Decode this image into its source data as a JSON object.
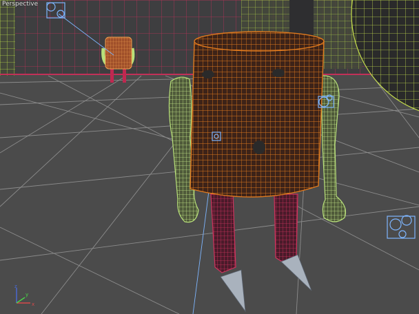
{
  "viewport": {
    "label": "Perspective",
    "active": true,
    "background": "#4b4b4b"
  },
  "colors": {
    "grid": "#8c8c8c",
    "character_body_wire": "#e07a1e",
    "character_body_fill": "#4a2a1c",
    "character_arm_wire": "#b8e07a",
    "character_leg_wire": "#d1335e",
    "foot_fill": "#a9b2bd",
    "light_helper": "#7eb6ff",
    "room_wall_wire": "#d1335e",
    "room_green_wire": "#b7d84a",
    "sphere_wire": "#c6de4c",
    "axis_x": "#d84a4a",
    "axis_y": "#4ad84a",
    "axis_z": "#4a6ad8"
  },
  "scene_objects": {
    "main_character": "robot-character",
    "background_character": "robot-character-small",
    "sphere": "wireframe-sphere",
    "lights": [
      "light-helper-top-left",
      "light-helper-right",
      "light-helper-center",
      "light-helper-bottom-right"
    ]
  },
  "axis_gizmo": {
    "x_label": "x",
    "y_label": "y",
    "z_label": "z"
  }
}
